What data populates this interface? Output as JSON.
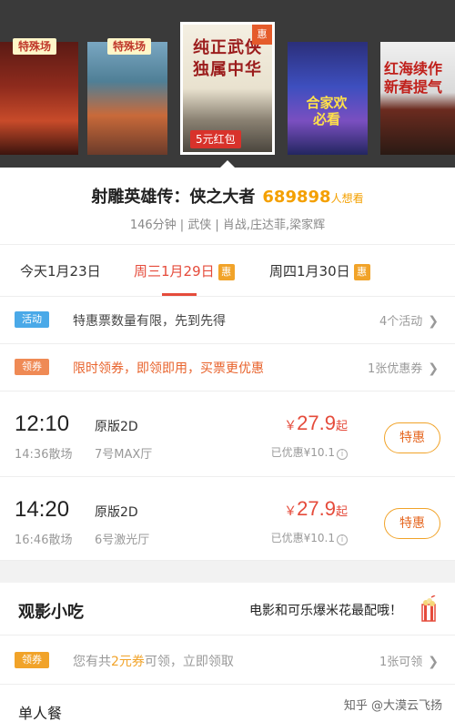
{
  "posters": {
    "tag_special_1": "特殊场",
    "tag_special_2": "特殊场",
    "selected_title": "纯正武侠独属中华",
    "selected_hui": "惠",
    "selected_redpacket": "5元红包",
    "p4_label": "合家欢必看",
    "p5_label": "红海续作新春提气"
  },
  "movie": {
    "title": "射雕英雄传：侠之大者",
    "score": "689898",
    "want_suffix": "人想看",
    "meta": "146分钟 | 武侠 | 肖战,庄达菲,梁家辉"
  },
  "dates": [
    {
      "label": "今天1月23日",
      "badge": ""
    },
    {
      "label": "周三1月29日",
      "badge": "惠"
    },
    {
      "label": "周四1月30日",
      "badge": "惠"
    }
  ],
  "promos": {
    "activity": {
      "tag": "活动",
      "text": "特惠票数量有限，先到先得",
      "right": "4个活动"
    },
    "coupon": {
      "tag": "领券",
      "text": "限时领券，即领即用，买票更优惠",
      "right": "1张优惠券"
    }
  },
  "showtimes": [
    {
      "time": "12:10",
      "end": "14:36散场",
      "lang": "原版2D",
      "hall": "7号MAX厅",
      "yen": "￥",
      "price": "27.9",
      "qi": "起",
      "discount": "已优惠¥10.1",
      "button": "特惠"
    },
    {
      "time": "14:20",
      "end": "16:46散场",
      "lang": "原版2D",
      "hall": "6号激光厅",
      "yen": "￥",
      "price": "27.9",
      "qi": "起",
      "discount": "已优惠¥10.1",
      "button": "特惠"
    }
  ],
  "snacks": {
    "title": "观影小吃",
    "slogan": "电影和可乐爆米花最配哦！",
    "coupon_tag": "领券",
    "coupon_text_pre": "您有共",
    "coupon_text_highlight": "2元券",
    "coupon_text_post": "可领，立即领取",
    "coupon_right": "1张可领",
    "single_meal": "单人餐"
  },
  "watermark": "知乎 @大漠云飞扬",
  "colors": {
    "accent_red": "#e54b3b",
    "accent_orange": "#f1a329",
    "score_yellow": "#f4a000",
    "activity_blue": "#4aa9e8"
  }
}
